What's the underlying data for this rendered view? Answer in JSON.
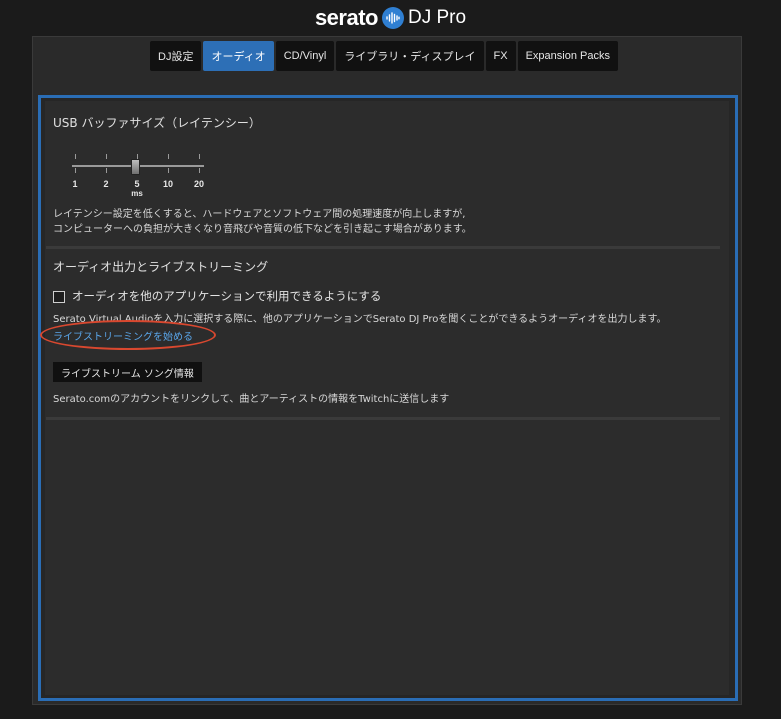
{
  "header": {
    "brand": "serato",
    "product": "DJ Pro",
    "logo_icon": "serato-waveform-icon"
  },
  "tabs": [
    {
      "label": "DJ設定",
      "active": false
    },
    {
      "label": "オーディオ",
      "active": true
    },
    {
      "label": "CD/Vinyl",
      "active": false
    },
    {
      "label": "ライブラリ・ディスプレイ",
      "active": false
    },
    {
      "label": "FX",
      "active": false
    },
    {
      "label": "Expansion Packs",
      "active": false
    }
  ],
  "usb_buffer": {
    "title": "USB バッファサイズ（レイテンシー）",
    "ticks": [
      "1",
      "2",
      "5",
      "10",
      "20"
    ],
    "unit": "ms",
    "selected_value": 5,
    "description_line1": "レイテンシー設定を低くすると、ハードウェアとソフトウェア間の処理速度が向上しますが,",
    "description_line2": "コンピューターへの負担が大きくなり音飛びや音質の低下などを引き起こす場合があります。"
  },
  "audio_output": {
    "title": "オーディオ出力とライブストリーミング",
    "checkbox_label": "オーディオを他のアプリケーションで利用できるようにする",
    "checkbox_checked": false,
    "description": "Serato Virtual Audioを入力に選択する際に、他のアプリケーションでSerato DJ Proを聞くことができるようオーディオを出力します。",
    "link_label": "ライブストリーミングを始める",
    "button_label": "ライブストリーム ソング情報",
    "button_description": "Serato.comのアカウントをリンクして、曲とアーティストの情報をTwitchに送信します"
  },
  "colors": {
    "accent": "#2d6fb6",
    "link": "#5aa6ea",
    "highlight": "#d9482f"
  }
}
